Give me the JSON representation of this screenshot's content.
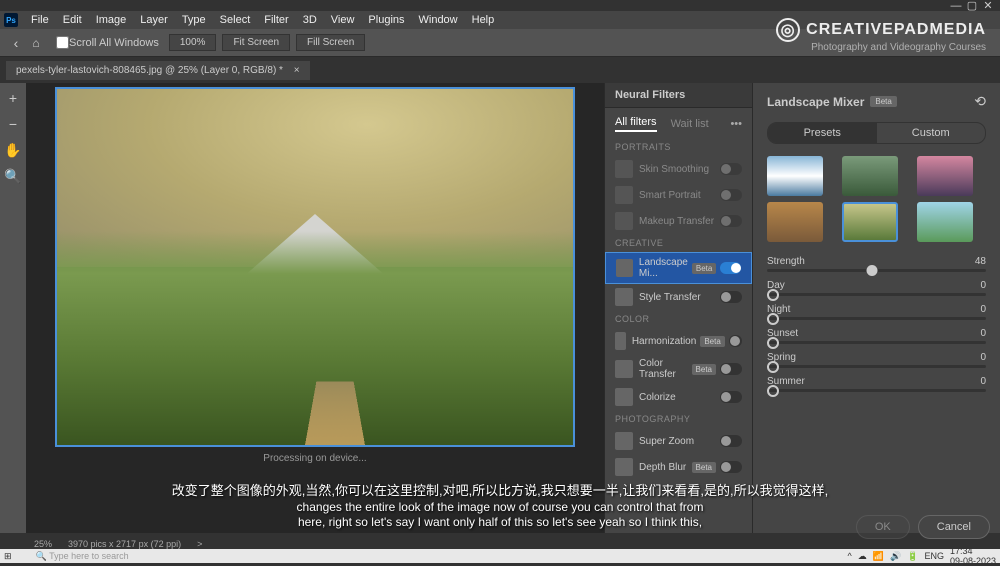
{
  "window": {
    "min": "—",
    "max": "▢",
    "close": "✕"
  },
  "menubar": [
    "File",
    "Edit",
    "Image",
    "Layer",
    "Type",
    "Select",
    "Filter",
    "3D",
    "View",
    "Plugins",
    "Window",
    "Help"
  ],
  "optionsbar": {
    "back": "‹",
    "home": "⌂",
    "scroll_all": "Scroll All Windows",
    "zoom": "100%",
    "fit": "Fit Screen",
    "fill": "Fill Screen"
  },
  "tab": {
    "title": "pexels-tyler-lastovich-808465.jpg @ 25% (Layer 0, RGB/8) *",
    "close": "×"
  },
  "tools": {
    "zoomin": "+",
    "zoomout": "−",
    "hand": "✋",
    "magnify": "🔍"
  },
  "processing": "Processing on device...",
  "neural": {
    "hdr": "Neural Filters",
    "tab_all": "All filters",
    "tab_wait": "Wait list",
    "sections": {
      "portraits": "PORTRAITS",
      "creative": "CREATIVE",
      "color": "COLOR",
      "photography": "PHOTOGRAPHY"
    },
    "filters": {
      "skin": "Skin Smoothing",
      "smart": "Smart Portrait",
      "makeup": "Makeup Transfer",
      "landscape": "Landscape Mi...",
      "style": "Style Transfer",
      "harmon": "Harmonization",
      "colortrans": "Color Transfer",
      "colorize": "Colorize",
      "superzoom": "Super Zoom",
      "depthblur": "Depth Blur"
    },
    "beta": "Beta"
  },
  "props": {
    "title": "Landscape Mixer",
    "beta": "Beta",
    "presets": "Presets",
    "custom": "Custom"
  },
  "sliders": {
    "strength": {
      "label": "Strength",
      "value": "48",
      "pos": 48
    },
    "day": {
      "label": "Day",
      "value": "0"
    },
    "night": {
      "label": "Night",
      "value": "0"
    },
    "sunset": {
      "label": "Sunset",
      "value": "0"
    },
    "spring": {
      "label": "Spring",
      "value": "0"
    },
    "summer": {
      "label": "Summer",
      "value": "0"
    }
  },
  "buttons": {
    "ok": "OK",
    "cancel": "Cancel"
  },
  "statusbar": {
    "zoom": "25%",
    "dims": "3970 pics x 2717 px (72 ppi)",
    "arrow": ">"
  },
  "subtitle": {
    "cn": "改变了整个图像的外观,当然,你可以在这里控制,对吧,所以比方说,我只想要一半,让我们来看看,是的,所以我觉得这样,",
    "en1": "changes the entire look of the image now of course you can control that from",
    "en2": "here, right so let's say I want only half of this so let's see yeah so I think this,"
  },
  "watermark": {
    "brand": "CREATIVEPADMEDIA",
    "sub": "Photography and Videography Courses"
  },
  "taskbar": {
    "search_ph": "Type here to search",
    "lang": "ENG",
    "time": "17:34",
    "date": "09-08-2023"
  }
}
